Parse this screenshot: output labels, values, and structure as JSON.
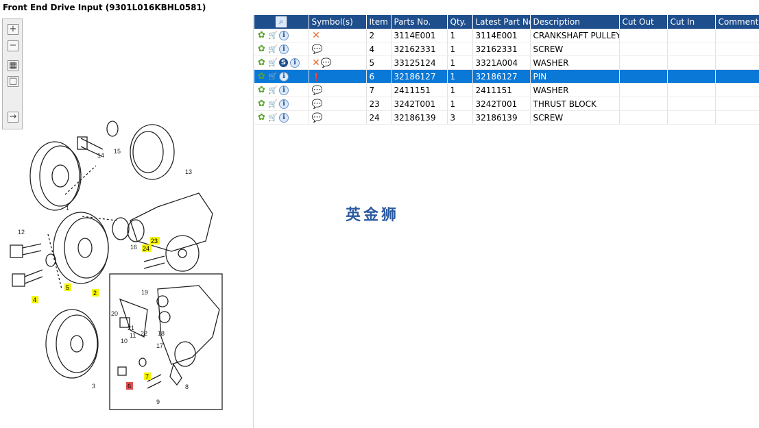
{
  "window": {
    "title": "Front End Drive Input (9301L016KBHL0581)"
  },
  "zoom_toolbar": {
    "items": [
      "zoom-in",
      "zoom-out",
      "fit-view",
      "actual-size",
      "toggle-list"
    ]
  },
  "diagram": {
    "callouts": [
      "1",
      "2",
      "3",
      "4",
      "5",
      "6",
      "7",
      "8",
      "9",
      "10",
      "11",
      "12",
      "13",
      "14",
      "15",
      "16",
      "17",
      "18",
      "19",
      "20",
      "21",
      "22",
      "23",
      "24"
    ],
    "highlighted": [
      "2",
      "4",
      "5",
      "7",
      "23",
      "24"
    ],
    "selected": "6"
  },
  "grid": {
    "headers": {
      "icon": "",
      "symbols": "Symbol(s)",
      "item": "Item",
      "parts_no": "Parts No.",
      "qty": "Qty.",
      "latest": "Latest Part No.",
      "desc": "Description",
      "cut_out": "Cut Out",
      "cut_in": "Cut In",
      "comment": "Comment"
    },
    "rows": [
      {
        "item": "2",
        "parts_no": "3114E001",
        "qty": "1",
        "latest": "3114E001",
        "desc": "CRANKSHAFT PULLEY",
        "cut_out": "",
        "cut_in": "",
        "comment": ""
      },
      {
        "item": "4",
        "parts_no": "32162331",
        "qty": "1",
        "latest": "32162331",
        "desc": "SCREW",
        "cut_out": "",
        "cut_in": "",
        "comment": ""
      },
      {
        "item": "5",
        "parts_no": "33125124",
        "qty": "1",
        "latest": "3321A004",
        "desc": "WASHER",
        "cut_out": "",
        "cut_in": "",
        "comment": ""
      },
      {
        "item": "6",
        "parts_no": "32186127",
        "qty": "1",
        "latest": "32186127",
        "desc": "PIN",
        "cut_out": "",
        "cut_in": "",
        "comment": ""
      },
      {
        "item": "7",
        "parts_no": "2411151",
        "qty": "1",
        "latest": "2411151",
        "desc": "WASHER",
        "cut_out": "",
        "cut_in": "",
        "comment": ""
      },
      {
        "item": "23",
        "parts_no": "3242T001",
        "qty": "1",
        "latest": "3242T001",
        "desc": "THRUST BLOCK",
        "cut_out": "",
        "cut_in": "",
        "comment": ""
      },
      {
        "item": "24",
        "parts_no": "32186139",
        "qty": "3",
        "latest": "32186139",
        "desc": "SCREW",
        "cut_out": "",
        "cut_in": "",
        "comment": ""
      }
    ]
  },
  "watermark": "英金狮"
}
